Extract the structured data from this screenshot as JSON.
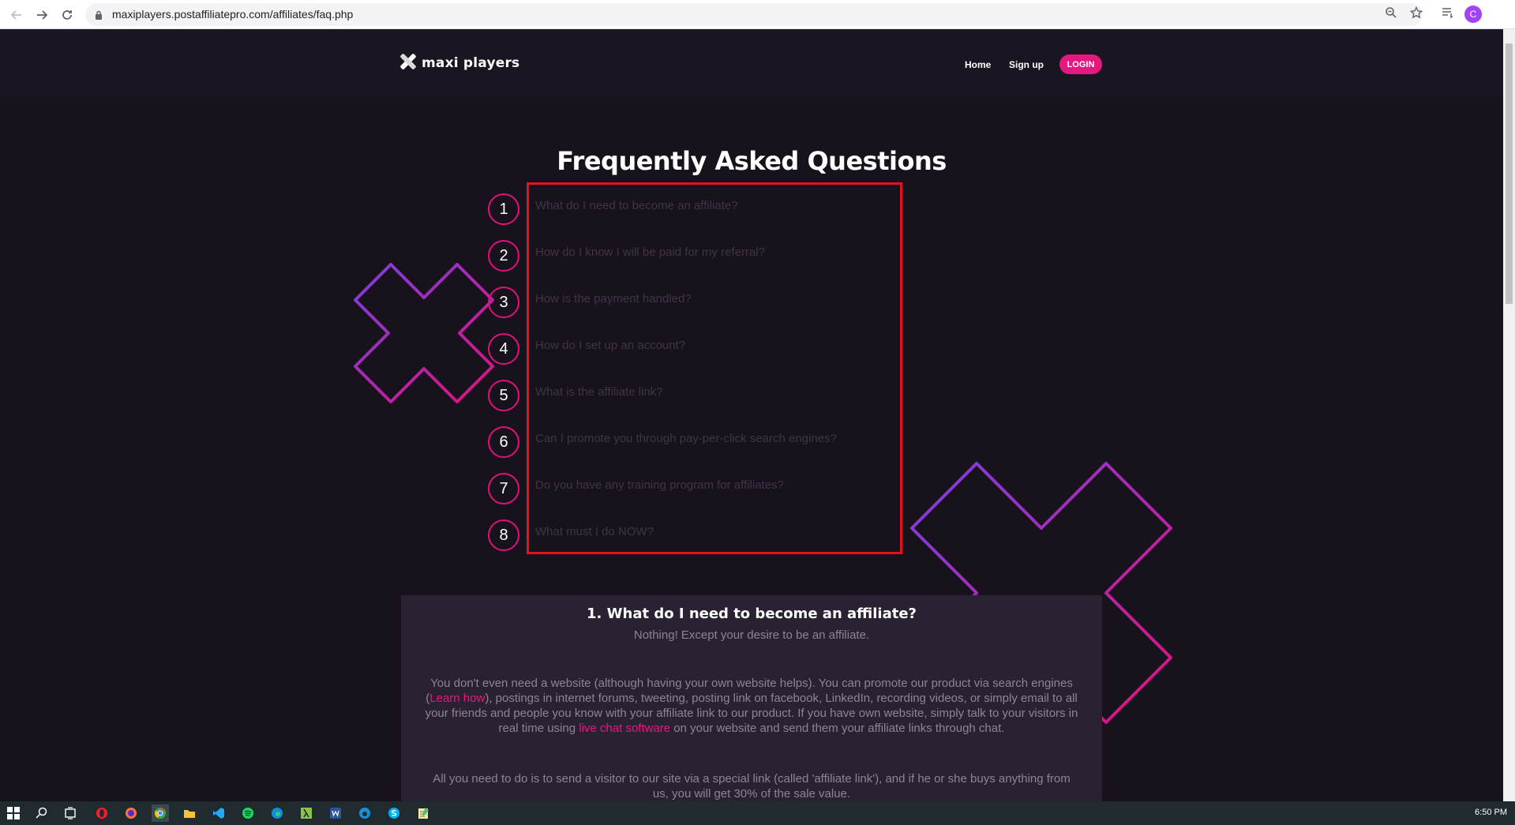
{
  "browser": {
    "url": "maxiplayers.postaffiliatepro.com/affiliates/faq.php",
    "profile_initial": "C"
  },
  "site": {
    "logo_text": "maxi players",
    "nav": {
      "home": "Home",
      "signup": "Sign up",
      "login": "LOGIN"
    },
    "brand_color": "#e5187f"
  },
  "faq": {
    "title": "Frequently Asked Questions",
    "questions": [
      {
        "num": "1",
        "text": "What do I need to become an affiliate?"
      },
      {
        "num": "2",
        "text": "How do I know I will be paid for my referral?"
      },
      {
        "num": "3",
        "text": "How is the payment handled?"
      },
      {
        "num": "4",
        "text": "How do I set up an account?"
      },
      {
        "num": "5",
        "text": "What is the affiliate link?"
      },
      {
        "num": "6",
        "text": "Can I promote you through pay-per-click search engines?"
      },
      {
        "num": "7",
        "text": "Do you have any training program for affiliates?"
      },
      {
        "num": "8",
        "text": "What must I do NOW?"
      }
    ]
  },
  "answer": {
    "title": "1. What do I need to become an affiliate?",
    "subtitle": "Nothing! Except your desire to be an affiliate.",
    "para1_a": "You don't even need a website (although having your own website helps). You can promote our product via search engines (",
    "para1_link1": "Learn how",
    "para1_b": "), postings in internet forums, tweeting, posting link on facebook, LinkedIn, recording videos, or simply email to all your friends and people you know with your affiliate link to our product. If you have own website, simply talk to your visitors in real time using ",
    "para1_link2": "live chat software",
    "para1_c": " on your website and send them your affiliate links through chat.",
    "para2": "All you need to do is to send a visitor to our site via a special link (called 'affiliate link'), and if he or she buys anything from us, you will get 30% of the sale value."
  },
  "taskbar": {
    "clock": "6:50 PM"
  }
}
